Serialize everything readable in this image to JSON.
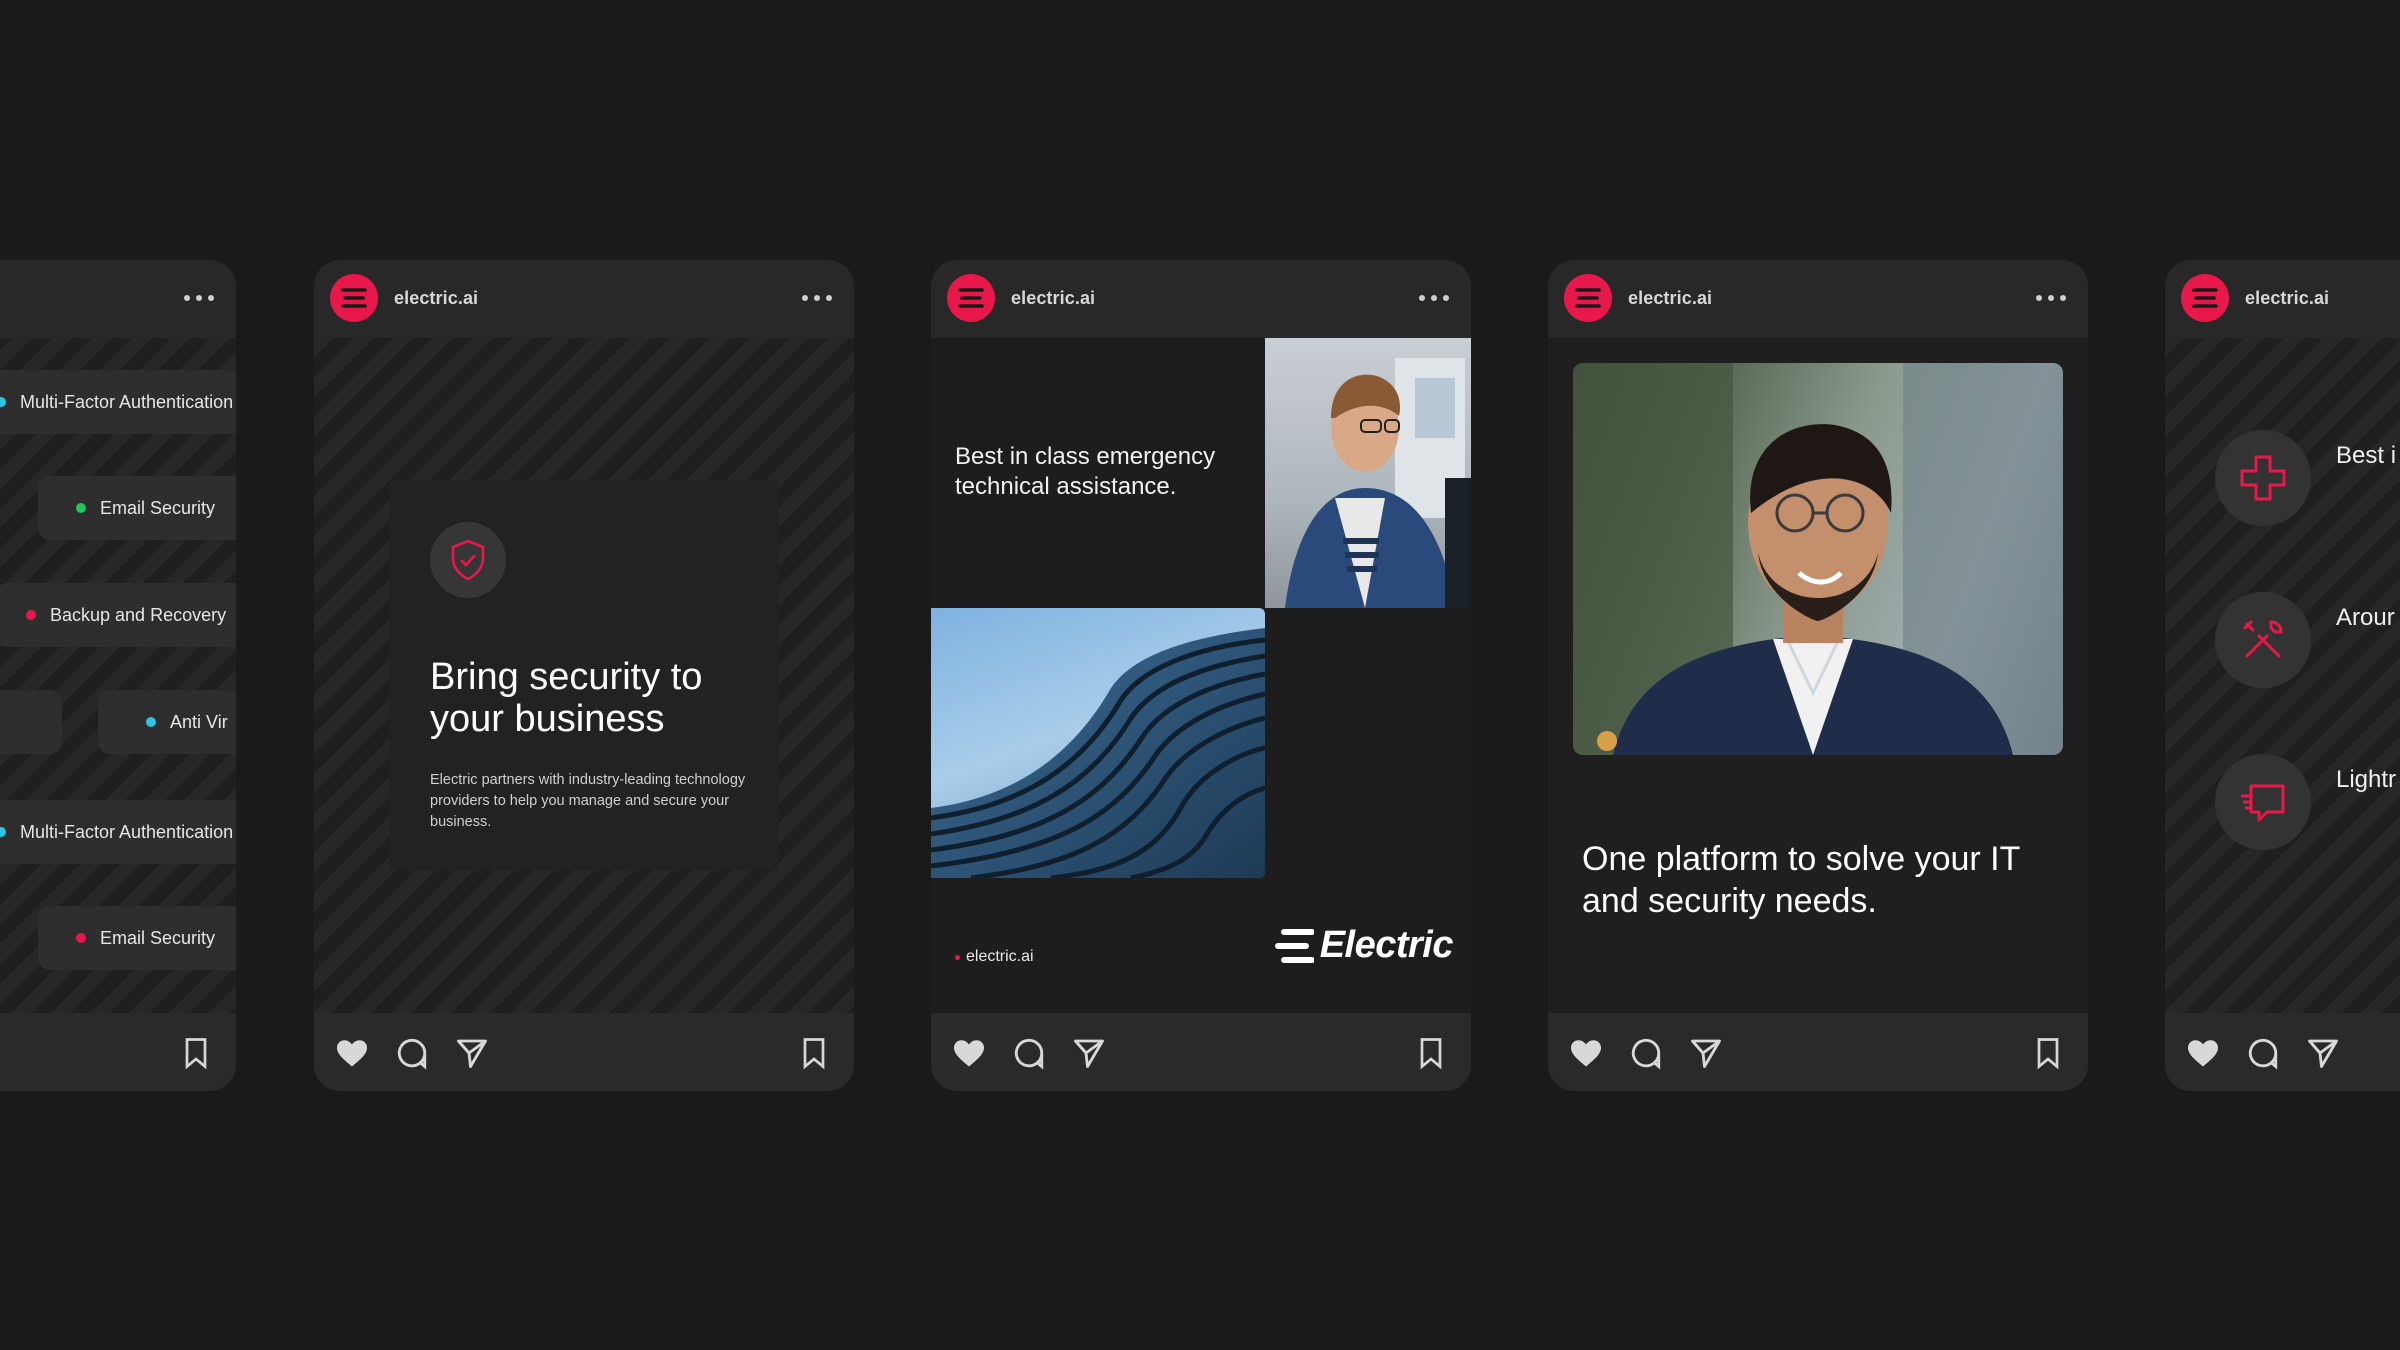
{
  "brand": {
    "handle": "electric.ai",
    "accent": "#e8194a",
    "logo_text": "Electric"
  },
  "card1": {
    "pills": [
      {
        "label": "Multi-Factor Authentication",
        "dot": "#2ec4e6"
      },
      {
        "label": "Email Security",
        "dot": "#22c55e"
      },
      {
        "label": "Backup and Recovery",
        "dot": "#e8194a"
      },
      {
        "label": "Anti Vir",
        "dot": "#2ec4e6"
      },
      {
        "label": "Multi-Factor Authentication",
        "dot": "#2ec4e6"
      },
      {
        "label": "Email Security",
        "dot": "#e8194a"
      }
    ]
  },
  "card2": {
    "title": "Bring security to your business",
    "body": "Electric partners with industry-leading technology providers to help you manage and secure your business."
  },
  "card3": {
    "text": "Best in class emergency technical assistance.",
    "handle": "electric.ai"
  },
  "card4": {
    "text": "One platform to solve your IT and security needs."
  },
  "card5": {
    "features": [
      {
        "text": "Best i techn",
        "icon": "medical-cross-icon"
      },
      {
        "text": "Arour troubl",
        "icon": "tools-icon"
      },
      {
        "text": "Lightr help r",
        "icon": "chat-icon"
      }
    ]
  },
  "icons": {
    "like": "heart-icon",
    "comment": "comment-icon",
    "share": "send-icon",
    "save": "bookmark-icon",
    "more": "more-icon"
  }
}
